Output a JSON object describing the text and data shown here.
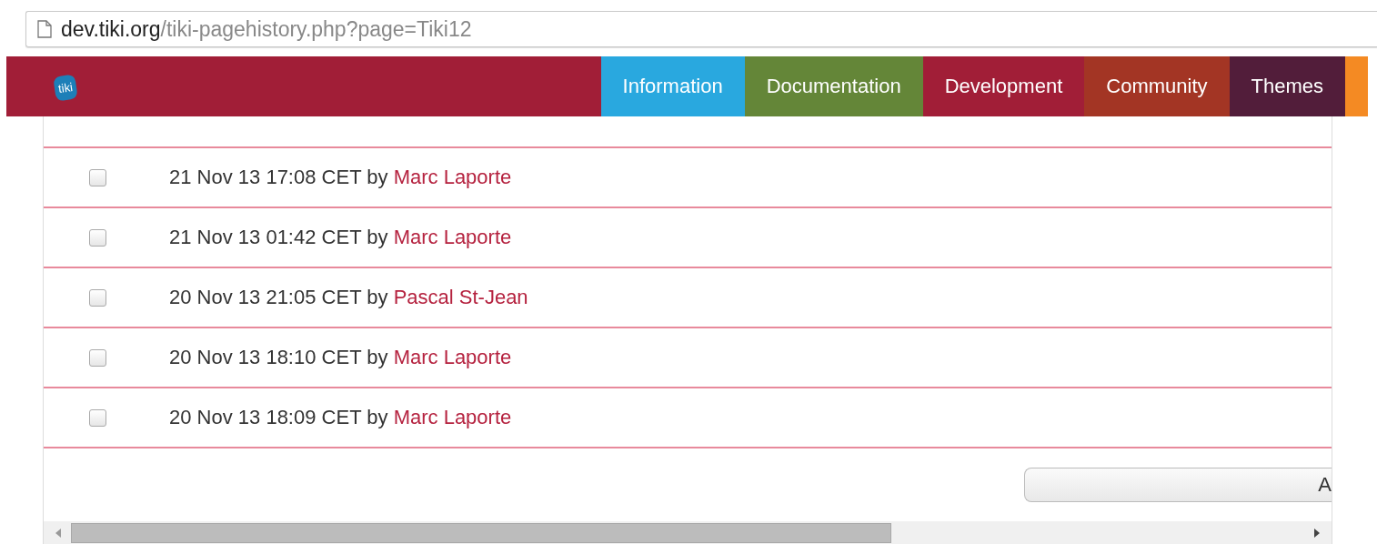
{
  "address_bar": {
    "host": "dev.tiki.org",
    "path": "/tiki-pagehistory.php?page=Tiki12"
  },
  "nav": {
    "logo": "tiki",
    "items": [
      {
        "label": "Information",
        "color": "#29a8df"
      },
      {
        "label": "Documentation",
        "color": "#648638"
      },
      {
        "label": "Development",
        "color": "#a11e37"
      },
      {
        "label": "Community",
        "color": "#a33524"
      },
      {
        "label": "Themes",
        "color": "#521d3a"
      }
    ]
  },
  "history": [
    {
      "checked": false,
      "date": "21 Nov 13 17:08 CET",
      "by": "by",
      "author": "Marc Laporte"
    },
    {
      "checked": false,
      "date": "21 Nov 13 01:42 CET",
      "by": "by",
      "author": "Marc Laporte"
    },
    {
      "checked": false,
      "date": "20 Nov 13 21:05 CET",
      "by": "by",
      "author": "Pascal St-Jean"
    },
    {
      "checked": false,
      "date": "20 Nov 13 18:10 CET",
      "by": "by",
      "author": "Marc Laporte"
    },
    {
      "checked": false,
      "date": "20 Nov 13 18:09 CET",
      "by": "by",
      "author": "Marc Laporte"
    }
  ],
  "action_button": "A"
}
